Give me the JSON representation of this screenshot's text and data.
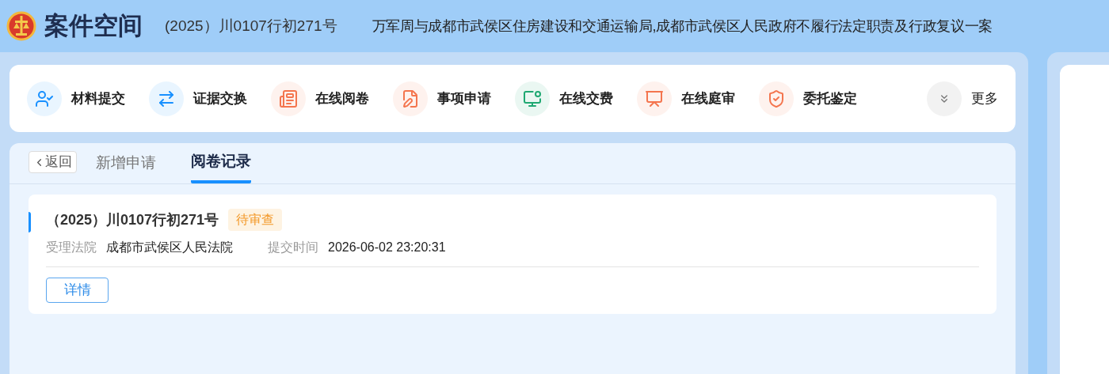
{
  "header": {
    "app_title": "案件空间",
    "case_number": "(2025）川0107行初271号",
    "case_title": "万军周与成都市武侯区住房建设和交通运输局,成都市武侯区人民政府不履行法定职责及行政复议一案"
  },
  "toolbar": [
    {
      "label": "材料提交",
      "kind": "user",
      "color": "#1890ff"
    },
    {
      "label": "证据交换",
      "kind": "exchange",
      "color": "#1890ff"
    },
    {
      "label": "在线阅卷",
      "kind": "news",
      "color": "#f4754e"
    },
    {
      "label": "事项申请",
      "kind": "form",
      "color": "#f4754e"
    },
    {
      "label": "在线交费",
      "kind": "pay",
      "color": "#1fa872"
    },
    {
      "label": "在线庭审",
      "kind": "court",
      "color": "#f4754e"
    },
    {
      "label": "委托鉴定",
      "kind": "shield",
      "color": "#f4754e"
    },
    {
      "label": "更多",
      "kind": "more",
      "color": "#777777"
    }
  ],
  "back_button": "返回",
  "tabs": [
    {
      "label": "新增申请",
      "selected": false
    },
    {
      "label": "阅卷记录",
      "selected": true
    }
  ],
  "records": [
    {
      "case_number": "（2025）川0107行初271号",
      "status": "待审查",
      "court_label": "受理法院",
      "court": "成都市武侯区人民法院",
      "time_label": "提交时间",
      "time": "2026-06-02 23:20:31",
      "action": "详情"
    }
  ]
}
